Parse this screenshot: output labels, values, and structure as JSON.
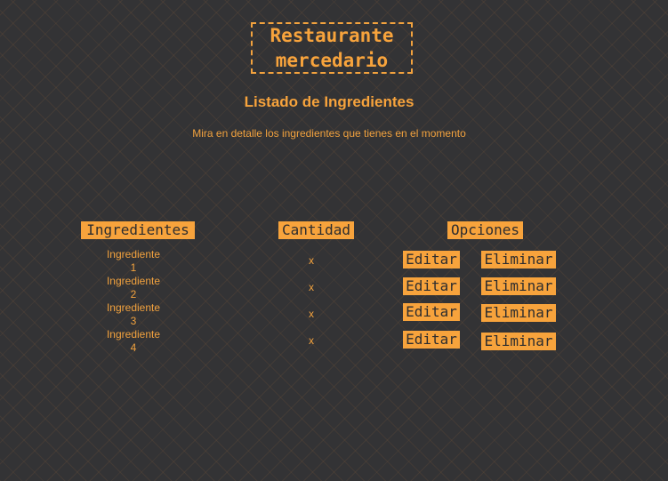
{
  "brand": {
    "name": "Restaurante\nmercedario"
  },
  "page": {
    "title": "Listado de Ingredientes",
    "subtitle": "Mira en detalle los ingredientes que tienes en el momento"
  },
  "table": {
    "headers": {
      "ingredients": "Ingredientes",
      "quantity": "Cantidad",
      "options": "Opciones"
    },
    "rows": [
      {
        "name": "Ingrediente\n1",
        "quantity": "x",
        "edit_label": "Editar",
        "delete_label": "Eliminar"
      },
      {
        "name": "Ingrediente\n2",
        "quantity": "x",
        "edit_label": "Editar",
        "delete_label": "Eliminar"
      },
      {
        "name": "Ingrediente\n3",
        "quantity": "x",
        "edit_label": "Editar",
        "delete_label": "Eliminar"
      },
      {
        "name": "Ingrediente\n4",
        "quantity": "x",
        "edit_label": "Editar",
        "delete_label": "Eliminar"
      }
    ]
  },
  "colors": {
    "accent": "#f7a33c",
    "background": "#333335",
    "button_text": "#2d2d2f"
  }
}
